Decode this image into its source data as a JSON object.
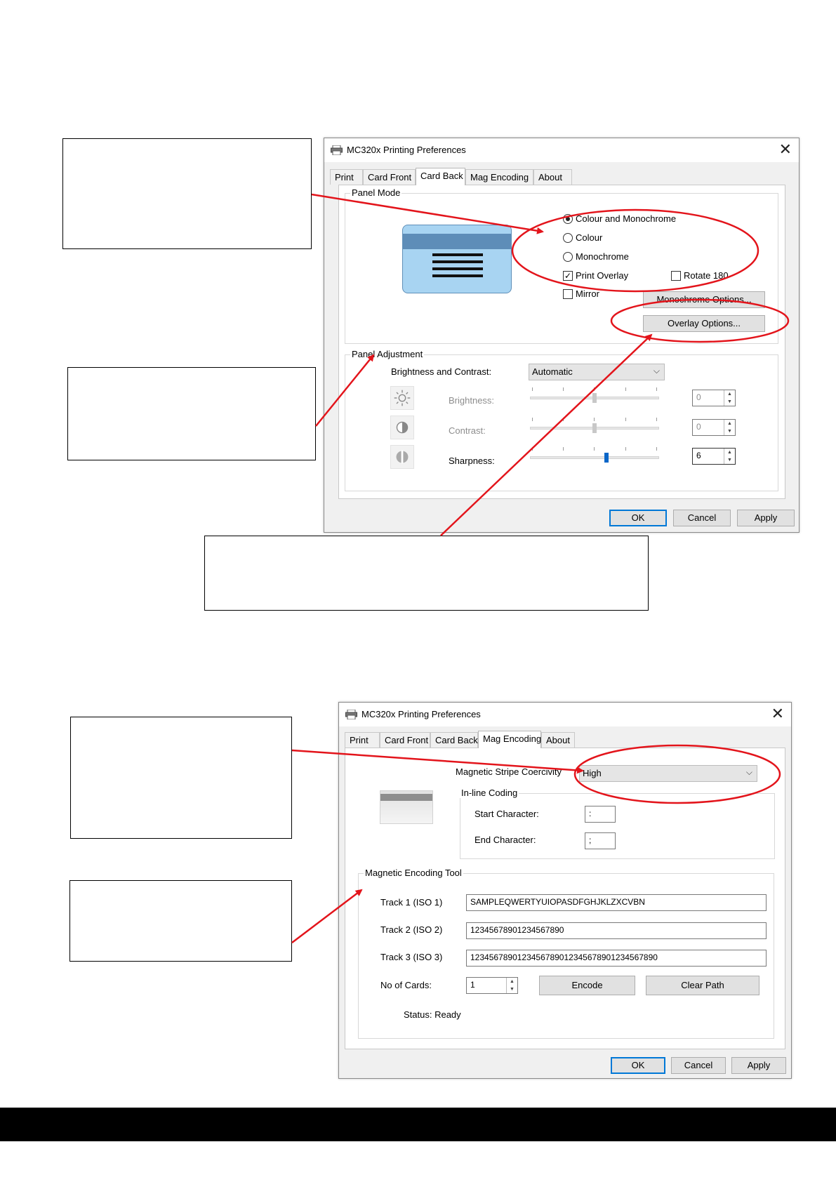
{
  "dialog_top": {
    "title": "MC320x Printing Preferences",
    "close_glyph": "✕",
    "icon": "printer-icon",
    "tabs": [
      "Print",
      "Card Front",
      "Card Back",
      "Mag Encoding",
      "About"
    ],
    "active_tab": "Card Back",
    "panel_mode": {
      "label": "Panel Mode",
      "options": [
        "Colour and Monochrome",
        "Colour",
        "Monochrome"
      ],
      "selected": "Colour and Monochrome",
      "print_overlay": {
        "label": "Print Overlay",
        "checked": true
      },
      "rotate_180": {
        "label": "Rotate 180",
        "checked": false
      },
      "mirror": {
        "label": "Mirror",
        "checked": false
      },
      "monochrome_options_label": "Monochrome Options...",
      "overlay_options_label": "Overlay Options..."
    },
    "panel_adjustment": {
      "label": "Panel Adjustment",
      "brightness_contrast_label": "Brightness and Contrast:",
      "brightness_contrast_value": "Automatic",
      "sliders": [
        {
          "label": "Brightness:",
          "value": "0",
          "enabled": false,
          "icon": "sun-icon"
        },
        {
          "label": "Contrast:",
          "value": "0",
          "enabled": false,
          "icon": "contrast-icon"
        },
        {
          "label": "Sharpness:",
          "value": "6",
          "enabled": true,
          "icon": "sharpness-icon"
        }
      ]
    },
    "buttons": {
      "ok": "OK",
      "cancel": "Cancel",
      "apply": "Apply"
    }
  },
  "dialog_bottom": {
    "title": "MC320x Printing Preferences",
    "close_glyph": "✕",
    "icon": "printer-icon",
    "tabs": [
      "Print",
      "Card Front",
      "Card Back",
      "Mag Encoding",
      "About"
    ],
    "active_tab": "Mag Encoding",
    "coercivity": {
      "label": "Magnetic Stripe Coercivity",
      "value": "High"
    },
    "inline_coding": {
      "label": "In-line Coding",
      "start_label": "Start Character:",
      "start_value": ":",
      "end_label": "End Character:",
      "end_value": ";"
    },
    "encoding_tool": {
      "label": "Magnetic Encoding Tool",
      "tracks": [
        {
          "label": "Track 1 (ISO 1)",
          "value": "SAMPLEQWERTYUIOPASDFGHJKLZXCVBN"
        },
        {
          "label": "Track 2 (ISO 2)",
          "value": "12345678901234567890"
        },
        {
          "label": "Track 3 (ISO 3)",
          "value": "1234567890123456789012345678901234567890"
        }
      ],
      "no_of_cards_label": "No of Cards:",
      "no_of_cards_value": "1",
      "encode_label": "Encode",
      "clear_path_label": "Clear Path",
      "status": "Status: Ready"
    },
    "buttons": {
      "ok": "OK",
      "cancel": "Cancel",
      "apply": "Apply"
    }
  },
  "colors": {
    "annotation_red": "#e3141b",
    "focus_blue": "#0078d7",
    "card_blue": "#a8d4f2",
    "slider_thumb_blue": "#0a66c8"
  }
}
